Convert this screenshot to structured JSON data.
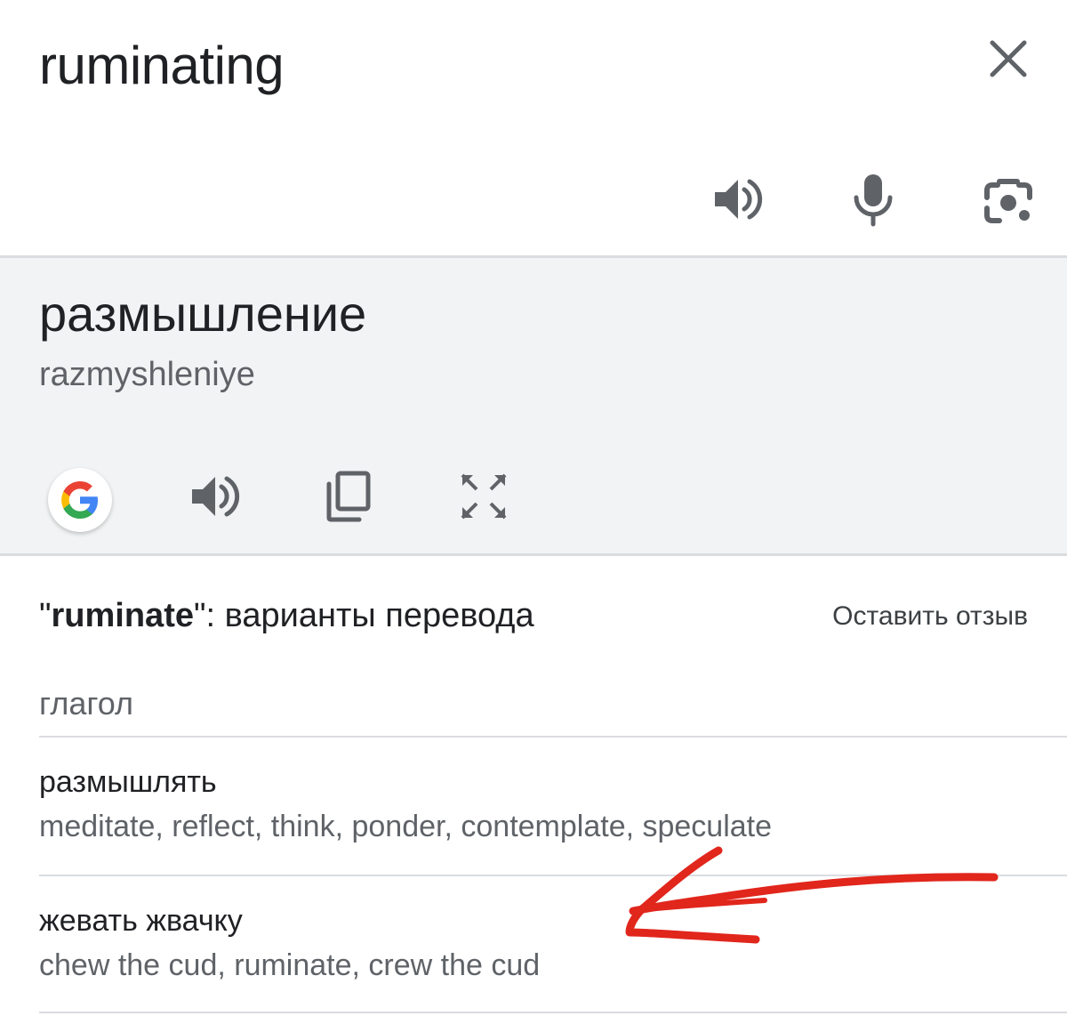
{
  "input": {
    "source_text": "ruminating",
    "close_icon": "close-icon",
    "actions": [
      {
        "name": "listen-source-button",
        "icon": "speaker-icon"
      },
      {
        "name": "voice-input-button",
        "icon": "microphone-icon"
      },
      {
        "name": "camera-input-button",
        "icon": "camera-icon"
      }
    ]
  },
  "result": {
    "translation": "размышление",
    "transliteration": "razmyshleniye",
    "actions": [
      {
        "name": "google-button",
        "icon": "google-logo-icon"
      },
      {
        "name": "listen-translation-button",
        "icon": "speaker-icon"
      },
      {
        "name": "copy-button",
        "icon": "copy-icon"
      },
      {
        "name": "fullscreen-button",
        "icon": "fullscreen-icon"
      }
    ]
  },
  "alternatives": {
    "heading_open_quote": "\"",
    "heading_word": "ruminate",
    "heading_rest": "\": варианты перевода",
    "feedback_label": "Оставить отзыв",
    "part_of_speech": "глагол",
    "entries": [
      {
        "word": "размышлять",
        "synonyms": "meditate, reflect, think, ponder, contemplate, speculate"
      },
      {
        "word": "жевать жвачку",
        "synonyms": "chew the cud, ruminate, crew the cud"
      }
    ]
  },
  "annotation": {
    "type": "hand-drawn-arrow",
    "color": "#e1261c"
  },
  "colors": {
    "primary_text": "#202124",
    "secondary_text": "#5f6368",
    "result_background": "#f1f3f4",
    "divider": "#dadce0",
    "icon_gray": "#5f6368"
  }
}
